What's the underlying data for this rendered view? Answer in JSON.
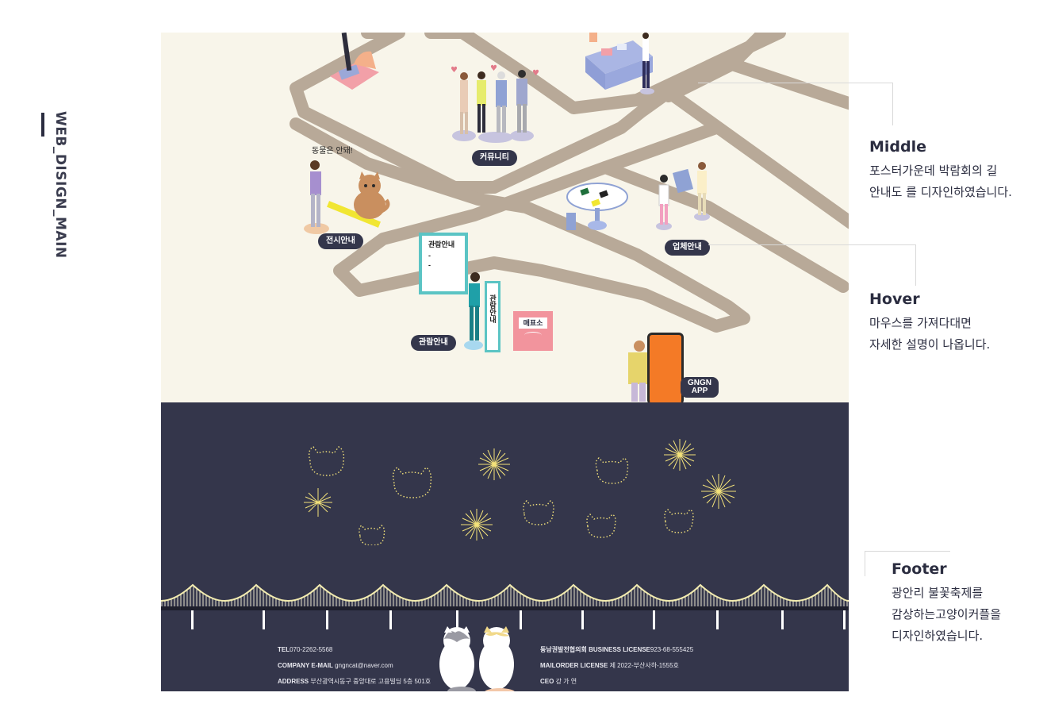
{
  "side": {
    "title": "WEB_DISIGN_MAIN"
  },
  "map": {
    "labels": {
      "community": "커뮤니티",
      "exhibition": "전시안내",
      "vendor": "업체안내",
      "tour": "관람안내",
      "app_line1": "GNGN",
      "app_line2": "APP"
    },
    "signs": {
      "speech": "동물은 안돼!",
      "board": "관람안내",
      "board_lines": "-\n-",
      "vertical": "관람안내",
      "ticket": "매표소"
    }
  },
  "footer": {
    "left": [
      {
        "label": "TEL",
        "value": "070-2262-5568"
      },
      {
        "label": "COMPANY E-MAIL",
        "value": "gngncat@naver.com"
      },
      {
        "label": "ADDRESS",
        "value": "부산광역시동구 중앙대로 고용빌딩 5층 501호"
      }
    ],
    "right": [
      {
        "label": "동남권발전협의회 BUSINESS LICENSE",
        "value": "923-68-555425"
      },
      {
        "label": "MAILORDER LICENSE",
        "value": "제 2022-부산사하-1555호"
      },
      {
        "label": "CEO",
        "value": "강 가 연"
      }
    ],
    "social": [
      "instagram-icon",
      "chat-icon",
      "blog-icon"
    ],
    "social_glyphs": [
      "◎",
      "●",
      "b"
    ]
  },
  "annotations": {
    "middle": {
      "title": "Middle",
      "desc": "포스터가운데 박람회의 길\n안내도 를 디자인하였습니다."
    },
    "hover": {
      "title": "Hover",
      "desc": "마우스를 가져다대면\n자세한 설명이 나옵니다."
    },
    "footer": {
      "title": "Footer",
      "desc": "광안리 불꽃축제를\n감상하는고양이커플을\n디자인하였습니다."
    }
  },
  "colors": {
    "map_bg": "#f8f5ea",
    "road": "#b8a998",
    "footer_bg": "#34364b",
    "label_bg": "#34364b",
    "firework": "#f3e27a",
    "app_phone": "#f47a26",
    "ticket_booth": "#f2949d",
    "board": "#5bc4c4"
  }
}
